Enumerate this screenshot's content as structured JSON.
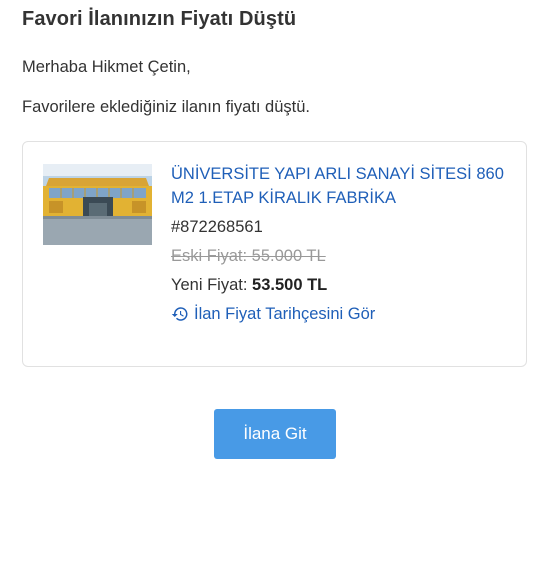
{
  "header": {
    "title": "Favori İlanınızın Fiyatı Düştü"
  },
  "body": {
    "greeting": "Merhaba Hikmet Çetin,",
    "message": "Favorilere eklediğiniz ilanın fiyatı düştü."
  },
  "listing": {
    "title": "ÜNİVERSİTE YAPI ARLI SANAYİ SİTESİ 860 M2 1.ETAP KİRALIK FABRİKA",
    "number": "#872268561",
    "old_price": "Eski Fiyat: 55.000 TL",
    "new_price_label": "Yeni Fiyat:",
    "new_price_value": "53.500 TL",
    "history_link": "İlan Fiyat Tarihçesini Gör",
    "history_icon": "history-clock-icon",
    "thumbnail_icon": "factory-building-photo"
  },
  "cta": {
    "label": "İlana Git"
  },
  "colors": {
    "link": "#1f5fb8",
    "button": "#489ae6",
    "text": "#333333",
    "muted": "#999999"
  }
}
